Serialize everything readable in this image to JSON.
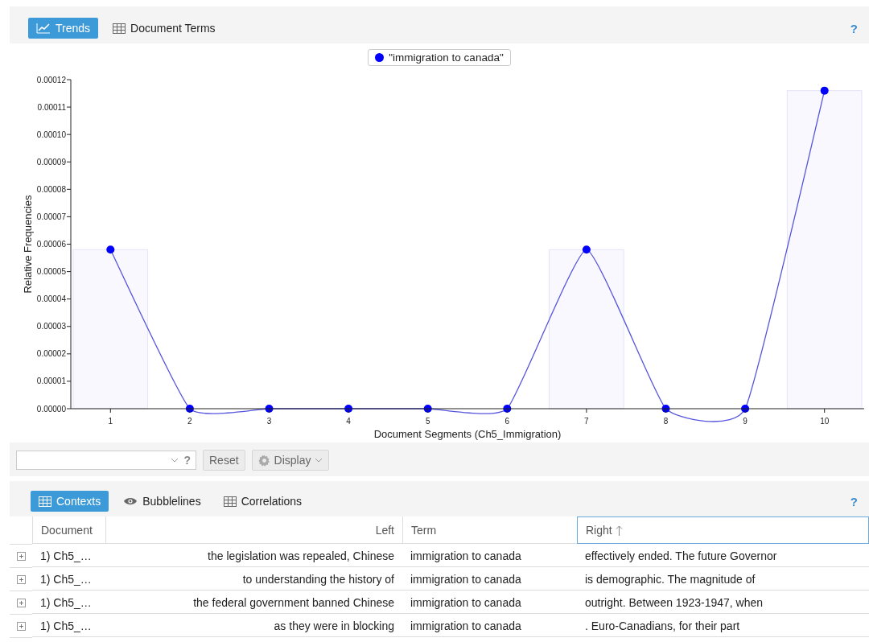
{
  "top_panel": {
    "tabs": [
      {
        "label": "Trends",
        "kind": "chart",
        "selected": true
      },
      {
        "label": "Document Terms",
        "kind": "table",
        "selected": false
      }
    ],
    "help": "?",
    "chart": {
      "chart_data": {
        "type": "line",
        "xlabel": "Document Segments (Ch5_Immigration)",
        "ylabel": "Relative Frequencies",
        "categories": [
          "1",
          "2",
          "3",
          "4",
          "5",
          "6",
          "7",
          "8",
          "9",
          "10"
        ],
        "series": [
          {
            "name": "\"immigration to canada\"",
            "marker": "circle",
            "color": "#0000ff",
            "values": [
              5.8e-05,
              0,
              0,
              0,
              0,
              0,
              5.8e-05,
              0,
              0,
              0.000116
            ]
          },
          {
            "type": "bar",
            "color": "#f8f8fe",
            "values": [
              5.8e-05,
              null,
              null,
              null,
              null,
              null,
              5.8e-05,
              null,
              null,
              0.000116
            ]
          }
        ],
        "ylim": [
          0,
          0.00012
        ],
        "yticks": [
          {
            "value": 0,
            "label": "0.00000"
          },
          {
            "value": 1e-05,
            "label": "0.00001"
          },
          {
            "value": 2e-05,
            "label": "0.00002"
          },
          {
            "value": 3e-05,
            "label": "0.00003"
          },
          {
            "value": 4e-05,
            "label": "0.00004"
          },
          {
            "value": 5e-05,
            "label": "0.00005"
          },
          {
            "value": 6e-05,
            "label": "0.00006"
          },
          {
            "value": 7e-05,
            "label": "0.00007"
          },
          {
            "value": 8e-05,
            "label": "0.00008"
          },
          {
            "value": 9e-05,
            "label": "0.00009"
          },
          {
            "value": 0.0001,
            "label": "0.00010"
          },
          {
            "value": 0.00011,
            "label": "0.00011"
          },
          {
            "value": 0.00012,
            "label": "0.00012"
          }
        ]
      }
    },
    "toolbar": {
      "help": "?",
      "reset": "Reset",
      "display": "Display"
    }
  },
  "bottom_panel": {
    "tabs": [
      {
        "label": "Contexts",
        "kind": "table",
        "selected": true
      },
      {
        "label": "Bubblelines",
        "kind": "eye",
        "selected": false
      },
      {
        "label": "Correlations",
        "kind": "table",
        "selected": false
      }
    ],
    "help": "?",
    "table": {
      "columns": [
        {
          "label": "Document",
          "sorted": false
        },
        {
          "label": "Left",
          "sorted": false
        },
        {
          "label": "Term",
          "sorted": false
        },
        {
          "label": "Right",
          "sorted": true
        }
      ],
      "rows": [
        [
          "1) Ch5_…",
          "the legislation was repealed, Chinese",
          "immigration to canada",
          "effectively ended. The future Governor"
        ],
        [
          "1) Ch5_…",
          "to understanding the history of",
          "immigration to canada",
          "is demographic. The magnitude of"
        ],
        [
          "1) Ch5_…",
          "the federal government banned Chinese",
          "immigration to canada",
          "outright. Between 1923-1947, when"
        ],
        [
          "1) Ch5_…",
          "as they were in blocking",
          "immigration to canada",
          ". Euro-Canadians, for their part"
        ]
      ]
    }
  }
}
